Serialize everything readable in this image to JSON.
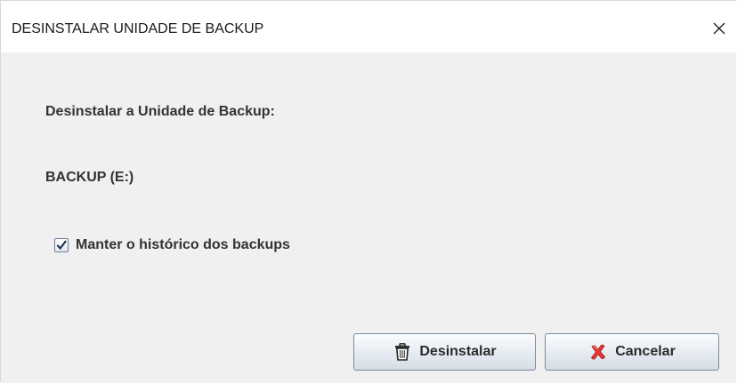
{
  "window": {
    "title": "DESINSTALAR UNIDADE DE BACKUP"
  },
  "content": {
    "heading": "Desinstalar a Unidade de Backup:",
    "drive_label": "BACKUP (E:)"
  },
  "options": {
    "keep_history_label": "Manter o histórico dos backups",
    "keep_history_checked": true
  },
  "buttons": {
    "uninstall_label": "Desinstalar",
    "uninstall_icon": "trash-icon",
    "cancel_label": "Cancelar",
    "cancel_icon": "red-x-icon"
  },
  "colors": {
    "content_background": "#f0f0f0",
    "titlebar_background": "#ffffff",
    "cancel_icon_color": "#e53935"
  }
}
